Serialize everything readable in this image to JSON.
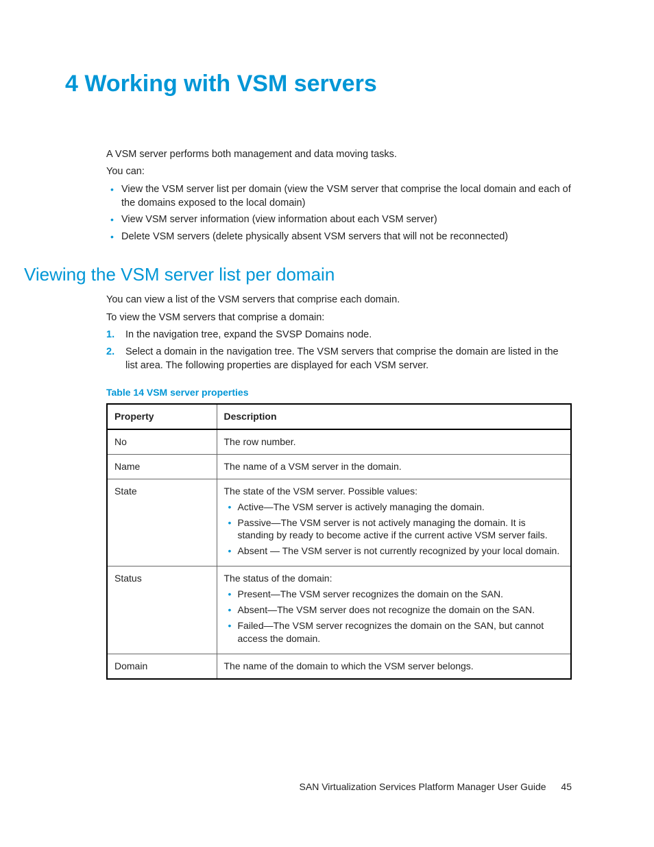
{
  "heading": "4 Working with VSM servers",
  "intro1": "A VSM server performs both management and data moving tasks.",
  "intro2": "You can:",
  "introBullets": [
    "View the VSM server list per domain (view the VSM server that comprise the local domain and each of the domains exposed to the local domain)",
    "View VSM server information (view information about each VSM server)",
    "Delete VSM servers (delete physically absent VSM servers that will not be reconnected)"
  ],
  "section": {
    "title": "Viewing the VSM server list per domain",
    "p1": "You can view a list of the VSM servers that comprise each domain.",
    "p2": "To view the VSM servers that comprise a domain:",
    "steps": [
      "In the navigation tree, expand the SVSP Domains node.",
      "Select a domain in the navigation tree. The VSM servers that comprise the domain are listed in the list area. The following properties are displayed for each VSM server."
    ]
  },
  "table": {
    "caption": "Table 14 VSM server properties",
    "headers": {
      "c1": "Property",
      "c2": "Description"
    },
    "rows": {
      "r0": {
        "prop": "No",
        "desc": "The row number."
      },
      "r1": {
        "prop": "Name",
        "desc": "The name of a VSM server in the domain."
      },
      "r2": {
        "prop": "State",
        "lead": "The state of the VSM server. Possible values:",
        "bullets": [
          "Active—The VSM server is actively managing the domain.",
          "Passive—The VSM server is not actively managing the domain. It is standing by ready to become active if the current active VSM server fails.",
          "Absent — The VSM server is not currently recognized by your local domain."
        ]
      },
      "r3": {
        "prop": "Status",
        "lead": "The status of the domain:",
        "bullets": [
          "Present—The VSM server recognizes the domain on the SAN.",
          "Absent—The VSM server does not recognize the domain on the SAN.",
          "Failed—The VSM server recognizes the domain on the SAN, but cannot access the domain."
        ]
      },
      "r4": {
        "prop": "Domain",
        "desc": "The name of the domain to which the VSM server belongs."
      }
    }
  },
  "footer": {
    "title": "SAN Virtualization Services Platform Manager User Guide",
    "page": "45"
  }
}
